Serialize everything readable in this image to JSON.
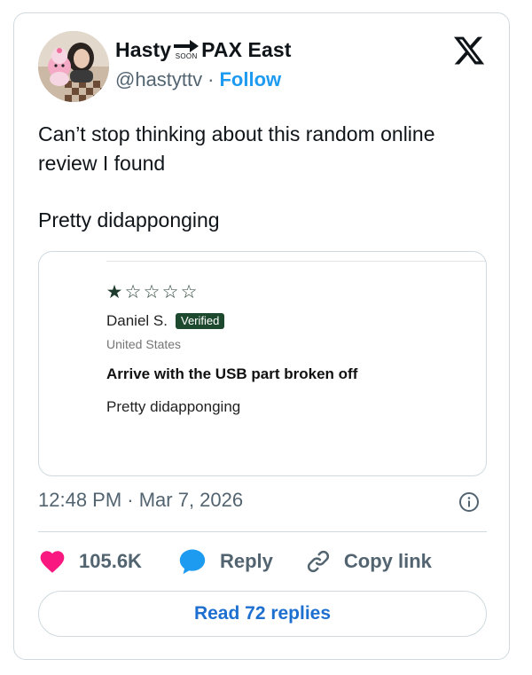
{
  "author": {
    "name_part1": "Hasty",
    "name_arrow_caption": "SOON",
    "name_part2": "PAX East",
    "handle": "@hastyttv",
    "separator": "·",
    "follow_label": "Follow",
    "avatar_icon": "avatar-photo",
    "platform_icon": "x-logo-icon"
  },
  "tweet": {
    "line1": "Can’t stop thinking about this random online review I found",
    "line2": "Pretty didapponging"
  },
  "embedded_review": {
    "rating": 1,
    "max_rating": 5,
    "stars_filled": "★",
    "stars_empty": "☆",
    "reviewer": "Daniel S.",
    "badge": "Verified",
    "country": "United States",
    "title": "Arrive with the USB part broken off",
    "body": "Pretty didapponging",
    "accent_color": "#1d4a2e"
  },
  "meta": {
    "timestamp": "12:48 PM · Mar 7, 2026",
    "info_icon": "info-icon"
  },
  "actions": {
    "like_count": "105.6K",
    "like_icon": "heart-icon",
    "like_color": "#f91880",
    "reply_label": "Reply",
    "reply_icon": "speech-bubble-icon",
    "reply_color": "#1d9bf0",
    "copy_label": "Copy link",
    "copy_icon": "link-icon"
  },
  "read_replies_label": "Read 72 replies"
}
